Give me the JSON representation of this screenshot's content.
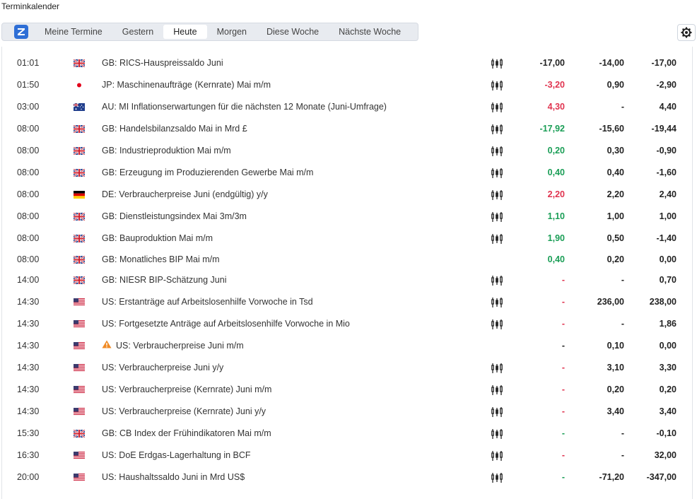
{
  "page_title": "Terminkalender",
  "tabs": [
    {
      "label": "Meine Termine",
      "active": false
    },
    {
      "label": "Gestern",
      "active": false
    },
    {
      "label": "Heute",
      "active": true
    },
    {
      "label": "Morgen",
      "active": false
    },
    {
      "label": "Diese Woche",
      "active": false
    },
    {
      "label": "Nächste Woche",
      "active": false
    }
  ],
  "colors": {
    "accent": "#2f6fd6",
    "positive": "#1a9e56",
    "negative": "#e0334f"
  },
  "rows": [
    {
      "time": "01:01",
      "flag": "GB",
      "title": "GB: RICS-Hauspreissaldo Juni",
      "chart": true,
      "actual": "-17,00",
      "actual_color": "dark",
      "forecast": "-14,00",
      "previous": "-17,00"
    },
    {
      "time": "01:50",
      "flag": "JP",
      "title": "JP: Maschinenaufträge (Kernrate) Mai m/m",
      "chart": true,
      "actual": "-3,20",
      "actual_color": "red",
      "forecast": "0,90",
      "previous": "-2,90"
    },
    {
      "time": "03:00",
      "flag": "AU",
      "title": "AU: MI Inflationserwartungen für die nächsten 12 Monate (Juni-Umfrage)",
      "chart": true,
      "actual": "4,30",
      "actual_color": "red",
      "forecast": "-",
      "previous": "4,40"
    },
    {
      "time": "08:00",
      "flag": "GB",
      "title": "GB: Handelsbilanzsaldo Mai in Mrd £",
      "chart": true,
      "actual": "-17,92",
      "actual_color": "green",
      "forecast": "-15,60",
      "previous": "-19,44"
    },
    {
      "time": "08:00",
      "flag": "GB",
      "title": "GB: Industrieproduktion Mai m/m",
      "chart": true,
      "actual": "0,20",
      "actual_color": "green",
      "forecast": "0,30",
      "previous": "-0,90"
    },
    {
      "time": "08:00",
      "flag": "GB",
      "title": "GB: Erzeugung im Produzierenden Gewerbe Mai m/m",
      "chart": true,
      "actual": "0,40",
      "actual_color": "green",
      "forecast": "0,40",
      "previous": "-1,60"
    },
    {
      "time": "08:00",
      "flag": "DE",
      "title": "DE: Verbraucherpreise Juni (endgültig) y/y",
      "chart": true,
      "actual": "2,20",
      "actual_color": "red",
      "forecast": "2,20",
      "previous": "2,40"
    },
    {
      "time": "08:00",
      "flag": "GB",
      "title": "GB: Dienstleistungsindex Mai 3m/3m",
      "chart": true,
      "actual": "1,10",
      "actual_color": "green",
      "forecast": "1,00",
      "previous": "1,00"
    },
    {
      "time": "08:00",
      "flag": "GB",
      "title": "GB: Bauproduktion Mai m/m",
      "chart": true,
      "actual": "1,90",
      "actual_color": "green",
      "forecast": "0,50",
      "previous": "-1,40"
    },
    {
      "time": "08:00",
      "flag": "GB",
      "title": "GB: Monatliches BIP Mai m/m",
      "chart": false,
      "actual": "0,40",
      "actual_color": "green",
      "forecast": "0,20",
      "previous": "0,00"
    },
    {
      "time": "14:00",
      "flag": "GB",
      "title": "GB: NIESR BIP-Schätzung Juni",
      "chart": true,
      "actual": "-",
      "actual_color": "red",
      "forecast": "-",
      "previous": "0,70"
    },
    {
      "time": "14:30",
      "flag": "US",
      "title": "US: Erstanträge auf Arbeitslosenhilfe Vorwoche in Tsd",
      "chart": true,
      "actual": "-",
      "actual_color": "red",
      "forecast": "236,00",
      "previous": "238,00"
    },
    {
      "time": "14:30",
      "flag": "US",
      "title": "US: Fortgesetzte Anträge auf Arbeitslosenhilfe Vorwoche in Mio",
      "chart": true,
      "actual": "-",
      "actual_color": "red",
      "forecast": "-",
      "previous": "1,86"
    },
    {
      "time": "14:30",
      "flag": "US",
      "title": "US: Verbraucherpreise Juni m/m",
      "chart": false,
      "warning": true,
      "actual": "-",
      "actual_color": "dark",
      "forecast": "0,10",
      "previous": "0,00"
    },
    {
      "time": "14:30",
      "flag": "US",
      "title": "US: Verbraucherpreise Juni y/y",
      "chart": true,
      "actual": "-",
      "actual_color": "red",
      "forecast": "3,10",
      "previous": "3,30"
    },
    {
      "time": "14:30",
      "flag": "US",
      "title": "US: Verbraucherpreise (Kernrate) Juni m/m",
      "chart": true,
      "actual": "-",
      "actual_color": "red",
      "forecast": "0,20",
      "previous": "0,20"
    },
    {
      "time": "14:30",
      "flag": "US",
      "title": "US: Verbraucherpreise (Kernrate) Juni y/y",
      "chart": true,
      "actual": "-",
      "actual_color": "red",
      "forecast": "3,40",
      "previous": "3,40"
    },
    {
      "time": "15:30",
      "flag": "GB",
      "title": "GB: CB Index der Frühindikatoren Mai m/m",
      "chart": true,
      "actual": "-",
      "actual_color": "green",
      "forecast": "-",
      "previous": "-0,10"
    },
    {
      "time": "16:30",
      "flag": "US",
      "title": "US: DoE Erdgas-Lagerhaltung in BCF",
      "chart": true,
      "actual": "-",
      "actual_color": "red",
      "forecast": "-",
      "previous": "32,00"
    },
    {
      "time": "20:00",
      "flag": "US",
      "title": "US: Haushaltssaldo Juni in Mrd US$",
      "chart": true,
      "actual": "-",
      "actual_color": "green",
      "forecast": "-71,20",
      "previous": "-347,00"
    }
  ]
}
